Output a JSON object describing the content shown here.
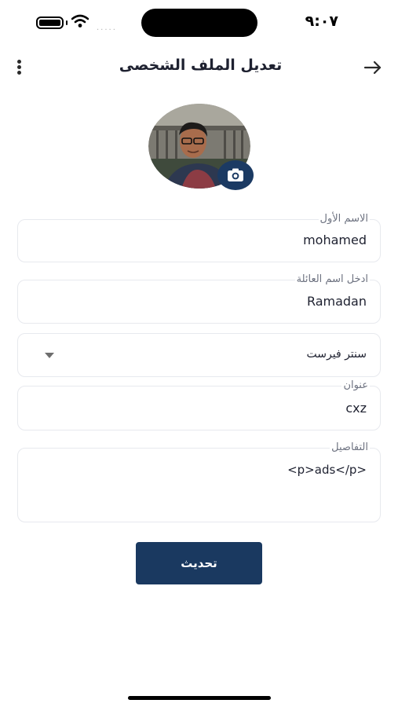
{
  "status_bar": {
    "time": "٩:٠٧",
    "signal_dots": "....."
  },
  "app_bar": {
    "title": "تعديل الملف الشخصى",
    "back_icon": "arrow-right-icon",
    "menu_icon": "more-vertical-icon"
  },
  "avatar": {
    "edit_icon": "camera-icon"
  },
  "form": {
    "first_name": {
      "label": "الاسم الأول",
      "value": "mohamed"
    },
    "last_name": {
      "label": "ادخل اسم العائلة",
      "value": "Ramadan"
    },
    "center": {
      "value": "سنتر فيرست"
    },
    "address": {
      "label": "عنوان",
      "value": "cxz"
    },
    "details": {
      "label": "التفاصيل",
      "value": "<p>ads</p>"
    }
  },
  "submit_label": "تحديث",
  "colors": {
    "primary": "#1a3960",
    "field_border": "#e7e9ee",
    "label": "#6d7280"
  }
}
